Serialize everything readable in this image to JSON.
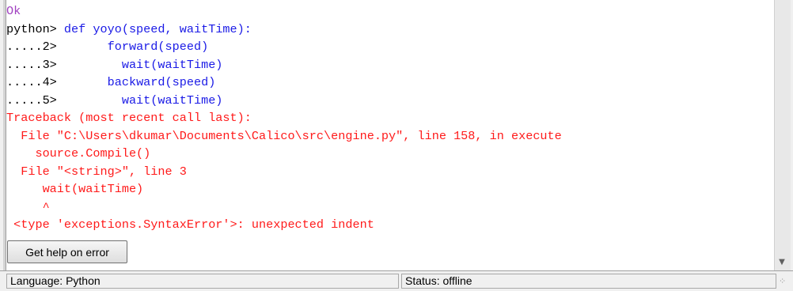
{
  "console": {
    "lines": [
      {
        "text": "Ok",
        "kind": "ok"
      },
      {
        "prompt": "python> ",
        "text": "def yoyo(speed, waitTime):",
        "kind": "code"
      },
      {
        "prompt": ".....2>       ",
        "text": "forward(speed)",
        "kind": "code"
      },
      {
        "prompt": ".....3>         ",
        "text": "wait(waitTime)",
        "kind": "code"
      },
      {
        "prompt": ".....4>       ",
        "text": "backward(speed)",
        "kind": "code"
      },
      {
        "prompt": ".....5>         ",
        "text": "wait(waitTime)",
        "kind": "code"
      },
      {
        "text": "Traceback (most recent call last):",
        "kind": "err"
      },
      {
        "text": "  File \"C:\\Users\\dkumar\\Documents\\Calico\\src\\engine.py\", line 158, in execute",
        "kind": "err"
      },
      {
        "text": "    source.Compile()",
        "kind": "err"
      },
      {
        "text": "  File \"<string>\", line 3",
        "kind": "err"
      },
      {
        "text": "     wait(waitTime)",
        "kind": "err"
      },
      {
        "text": "     ^",
        "kind": "err"
      },
      {
        "text": " <type 'exceptions.SyntaxError'>: unexpected indent",
        "kind": "err"
      }
    ]
  },
  "help_button_label": "Get help on error",
  "status": {
    "language": "Language: Python",
    "connection": "Status: offline"
  },
  "icons": {
    "scroll_down": "scroll-down-arrow",
    "resize_grip": "resize-grip"
  },
  "colors": {
    "ok": "#a040c0",
    "code": "#1a1ae6",
    "error": "#ff1a1a"
  }
}
